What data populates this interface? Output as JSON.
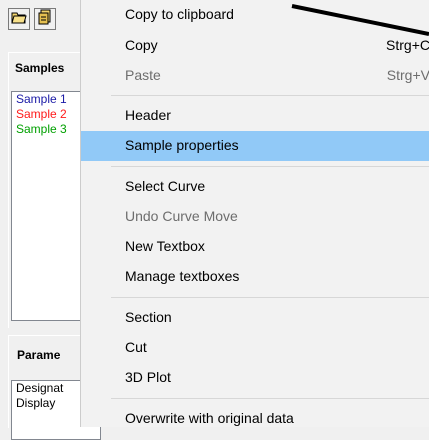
{
  "left_panel": {
    "samples_title": "Samples",
    "samples": [
      {
        "label": "Sample 1",
        "color": "#1a1aa6"
      },
      {
        "label": "Sample 2",
        "color": "#ff1a1a"
      },
      {
        "label": "Sample 3",
        "color": "#00a000"
      }
    ],
    "params_title": "Parame",
    "params": [
      "Designat",
      "Display"
    ]
  },
  "menu": {
    "items": [
      {
        "label": "Copy to clipboard",
        "shortcut": "",
        "disabled": false
      },
      {
        "label": "Copy",
        "shortcut": "Strg+C",
        "disabled": false
      },
      {
        "label": "Paste",
        "shortcut": "Strg+V",
        "disabled": true
      },
      {
        "label": "Header",
        "shortcut": "",
        "disabled": false
      },
      {
        "label": "Sample properties",
        "shortcut": "",
        "disabled": false,
        "highlighted": true
      },
      {
        "label": "Select Curve",
        "shortcut": "",
        "disabled": false
      },
      {
        "label": "Undo Curve Move",
        "shortcut": "",
        "disabled": true
      },
      {
        "label": "New Textbox",
        "shortcut": "",
        "disabled": false
      },
      {
        "label": "Manage textboxes",
        "shortcut": "",
        "disabled": false
      },
      {
        "label": "Section",
        "shortcut": "",
        "disabled": false
      },
      {
        "label": "Cut",
        "shortcut": "",
        "disabled": false
      },
      {
        "label": "3D Plot",
        "shortcut": "",
        "disabled": false
      },
      {
        "label": "Overwrite with original data",
        "shortcut": "",
        "disabled": false
      }
    ]
  },
  "colors": {
    "highlight": "#91c9f7",
    "menu_bg": "#f2f2f2",
    "disabled_text": "#6d6d6d"
  }
}
